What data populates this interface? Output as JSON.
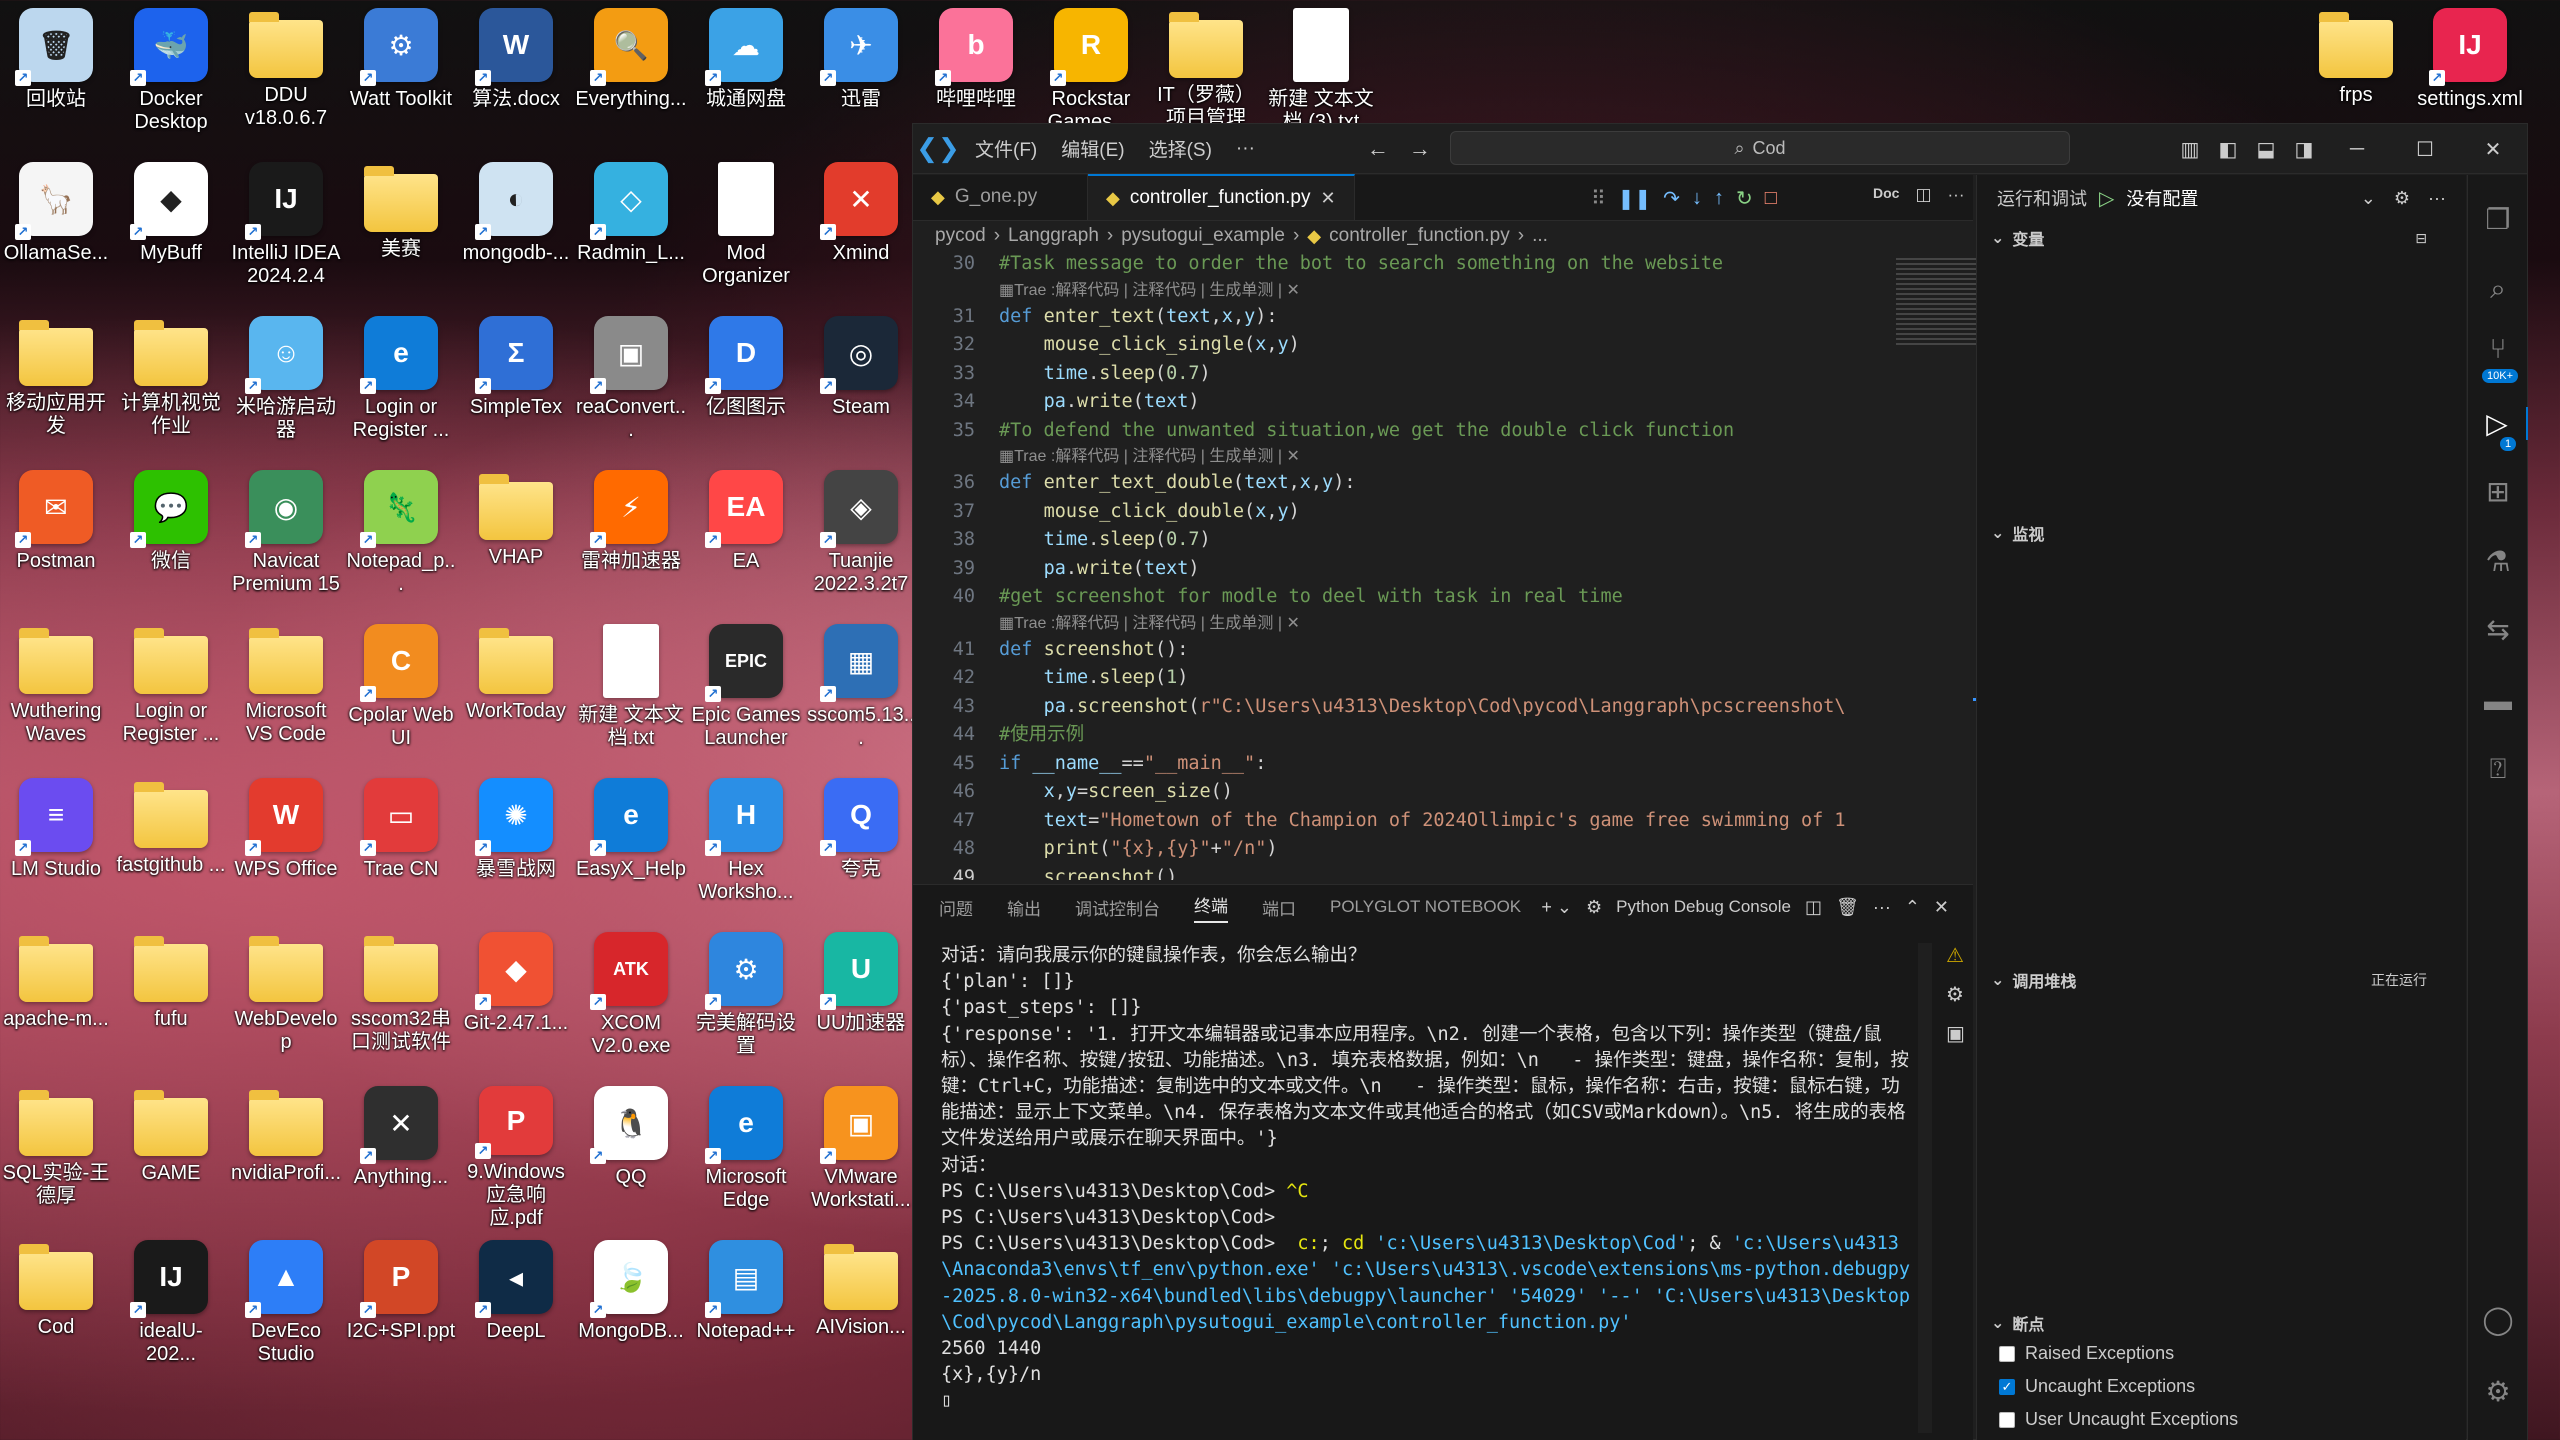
{
  "desktop": {
    "icons": [
      {
        "label": "回收站",
        "glyph": "🗑",
        "bg": "#bcd7ee"
      },
      {
        "label": "Docker Desktop",
        "glyph": "🐳",
        "bg": "#1d63ed"
      },
      {
        "label": "DDU v18.0.6.7",
        "glyph": "",
        "bg": "folder"
      },
      {
        "label": "Watt Toolkit",
        "glyph": "⚙",
        "bg": "#3b7bd6"
      },
      {
        "label": "算法.docx",
        "glyph": "W",
        "bg": "#2b579a"
      },
      {
        "label": "Everything...",
        "glyph": "🔍",
        "bg": "#f39c12"
      },
      {
        "label": "城通网盘",
        "glyph": "☁",
        "bg": "#3ba2e6"
      },
      {
        "label": "迅雷",
        "glyph": "✈",
        "bg": "#3a8ee6"
      },
      {
        "label": "哔哩哔哩",
        "glyph": "b",
        "bg": "#fb7299"
      },
      {
        "label": "Rockstar Games ...",
        "glyph": "R",
        "bg": "#f7b500"
      },
      {
        "label": "IT（罗薇）项目管理",
        "glyph": "",
        "bg": "folder"
      },
      {
        "label": "新建 文本文档 (3).txt",
        "glyph": "",
        "bg": "doc"
      },
      {
        "label": "frps",
        "glyph": "",
        "bg": "folder"
      },
      {
        "label": "settings.xml",
        "glyph": "IJ",
        "bg": "#e8254f"
      },
      {
        "label": "OllamaSe...",
        "glyph": "🦙",
        "bg": "#f5f5f5"
      },
      {
        "label": "MyBuff",
        "glyph": "◆",
        "bg": "#ffffff"
      },
      {
        "label": "IntelliJ IDEA 2024.2.4",
        "glyph": "IJ",
        "bg": "#1a1a1a"
      },
      {
        "label": "美赛",
        "glyph": "",
        "bg": "folder"
      },
      {
        "label": "mongodb-...",
        "glyph": "◐",
        "bg": "#cfe3f2"
      },
      {
        "label": "Radmin_L...",
        "glyph": "◇",
        "bg": "#35b1e0"
      },
      {
        "label": "Mod Organizer",
        "glyph": "",
        "bg": "doc"
      },
      {
        "label": "Xmind",
        "glyph": "✕",
        "bg": "#e23c2c"
      },
      {
        "label": "移动应用开发",
        "glyph": "",
        "bg": "folder"
      },
      {
        "label": "计算机视觉作业",
        "glyph": "",
        "bg": "folder"
      },
      {
        "label": "米哈游启动器",
        "glyph": "☺",
        "bg": "#59b6ef"
      },
      {
        "label": "Login or Register ...",
        "glyph": "e",
        "bg": "#0f7cd8"
      },
      {
        "label": "SimpleTex",
        "glyph": "Σ",
        "bg": "#2f6fd6"
      },
      {
        "label": "reaConvert...",
        "glyph": "▣",
        "bg": "#8a8a8a"
      },
      {
        "label": "亿图图示",
        "glyph": "D",
        "bg": "#2f79e8"
      },
      {
        "label": "Steam",
        "glyph": "◎",
        "bg": "#1b2838"
      },
      {
        "label": "Postman",
        "glyph": "✉",
        "bg": "#ef5b25"
      },
      {
        "label": "微信",
        "glyph": "💬",
        "bg": "#2dc100"
      },
      {
        "label": "Navicat Premium 15",
        "glyph": "◉",
        "bg": "#3a8f5b"
      },
      {
        "label": "Notepad_p...",
        "glyph": "🦎",
        "bg": "#8fd14f"
      },
      {
        "label": "VHAP",
        "glyph": "",
        "bg": "folder"
      },
      {
        "label": "雷神加速器",
        "glyph": "⚡",
        "bg": "#ff6a00"
      },
      {
        "label": "EA",
        "glyph": "EA",
        "bg": "#ff4747"
      },
      {
        "label": "Tuanjie 2022.3.2t7",
        "glyph": "◈",
        "bg": "#444444"
      },
      {
        "label": "Wuthering Waves",
        "glyph": "",
        "bg": "folder"
      },
      {
        "label": "Login or Register ...",
        "glyph": "",
        "bg": "folder"
      },
      {
        "label": "Microsoft VS Code",
        "glyph": "",
        "bg": "folder"
      },
      {
        "label": "Cpolar Web UI",
        "glyph": "C",
        "bg": "#f28c1f"
      },
      {
        "label": "WorkToday",
        "glyph": "",
        "bg": "folder"
      },
      {
        "label": "新建 文本文档.txt",
        "glyph": "",
        "bg": "doc"
      },
      {
        "label": "Epic Games Launcher",
        "glyph": "EPIC",
        "bg": "#2a2a2a"
      },
      {
        "label": "sscom5.13...",
        "glyph": "▦",
        "bg": "#2d6fb5"
      },
      {
        "label": "LM Studio",
        "glyph": "≡",
        "bg": "#6b4cf0"
      },
      {
        "label": "fastgithub ...",
        "glyph": "",
        "bg": "folder"
      },
      {
        "label": "WPS Office",
        "glyph": "W",
        "bg": "#e33b2e"
      },
      {
        "label": "Trae CN",
        "glyph": "▭",
        "bg": "#e23b3b"
      },
      {
        "label": "暴雪战网",
        "glyph": "✺",
        "bg": "#148eff"
      },
      {
        "label": "EasyX_Help",
        "glyph": "e",
        "bg": "#0f7cd8"
      },
      {
        "label": "Hex Worksho...",
        "glyph": "H",
        "bg": "#2b8fe6"
      },
      {
        "label": "夸克",
        "glyph": "Q",
        "bg": "#3a6cf4"
      },
      {
        "label": "apache-m...",
        "glyph": "",
        "bg": "folder"
      },
      {
        "label": "fufu",
        "glyph": "",
        "bg": "folder"
      },
      {
        "label": "WebDevelop",
        "glyph": "",
        "bg": "folder"
      },
      {
        "label": "sscom32串口测试软件",
        "glyph": "",
        "bg": "folder"
      },
      {
        "label": "Git-2.47.1...",
        "glyph": "◆",
        "bg": "#f05133"
      },
      {
        "label": "XCOM V2.0.exe",
        "glyph": "ATK",
        "bg": "#d7262b"
      },
      {
        "label": "完美解码设置",
        "glyph": "⚙",
        "bg": "#2e86de"
      },
      {
        "label": "UU加速器",
        "glyph": "U",
        "bg": "#18b7a3"
      },
      {
        "label": "SQL实验-王德厚",
        "glyph": "",
        "bg": "folder"
      },
      {
        "label": "GAME",
        "glyph": "",
        "bg": "folder"
      },
      {
        "label": "nvidiaProfi...",
        "glyph": "",
        "bg": "folder"
      },
      {
        "label": "Anything...",
        "glyph": "✕",
        "bg": "#2f2f2f"
      },
      {
        "label": "9.Windows 应急响应.pdf",
        "glyph": "P",
        "bg": "#e23b3b"
      },
      {
        "label": "QQ",
        "glyph": "🐧",
        "bg": "#ffffff"
      },
      {
        "label": "Microsoft Edge",
        "glyph": "e",
        "bg": "#0f7cd8"
      },
      {
        "label": "VMware Workstati...",
        "glyph": "▣",
        "bg": "#f7931e"
      },
      {
        "label": "Cod",
        "glyph": "",
        "bg": "folder"
      },
      {
        "label": "idealU-202...",
        "glyph": "IJ",
        "bg": "#1a1a1a"
      },
      {
        "label": "DevEco Studio",
        "glyph": "▲",
        "bg": "#2d7ef7"
      },
      {
        "label": "I2C+SPI.ppt",
        "glyph": "P",
        "bg": "#d24726"
      },
      {
        "label": "DeepL",
        "glyph": "◂",
        "bg": "#0f2b46"
      },
      {
        "label": "MongoDB...",
        "glyph": "🍃",
        "bg": "#ffffff"
      },
      {
        "label": "Notepad++",
        "glyph": "▤",
        "bg": "#2f8fe0"
      },
      {
        "label": "AIVision...",
        "glyph": "",
        "bg": "folder"
      }
    ]
  },
  "window": {
    "menu": [
      "文件(F)",
      "编辑(E)",
      "选择(S)",
      "···"
    ],
    "command_center": "Cod",
    "tabs": [
      {
        "label": "G_one.py",
        "active": false
      },
      {
        "label": "controller_function.py",
        "active": true
      }
    ],
    "breadcrumb": [
      "pycod",
      "Langgraph",
      "pysutogui_example",
      "controller_function.py",
      "..."
    ],
    "doc_label": "Doc"
  },
  "code": {
    "lens": "Trae :解释代码 | 注释代码 | 生成单测 | ✕",
    "lines": [
      {
        "n": "30",
        "html": "<span class=\"comment\">#Task message to order the bot to search something on the website</span>"
      },
      {
        "lens": true
      },
      {
        "n": "31",
        "html": "<span class=\"kw\">def</span> <span class=\"fn\">enter_text</span>(<span class=\"var\">text</span>,<span class=\"var\">x</span>,<span class=\"var\">y</span>):"
      },
      {
        "n": "32",
        "html": "    <span class=\"fn\">mouse_click_single</span>(<span class=\"var\">x</span>,<span class=\"var\">y</span>)"
      },
      {
        "n": "33",
        "html": "    <span class=\"var\">time</span>.<span class=\"fn\">sleep</span>(<span class=\"num\">0.7</span>)"
      },
      {
        "n": "34",
        "html": "    <span class=\"var\">pa</span>.<span class=\"fn\">write</span>(<span class=\"var\">text</span>)"
      },
      {
        "n": "35",
        "html": "<span class=\"comment\">#To defend the unwanted situation,we get the double click function</span>"
      },
      {
        "lens": true
      },
      {
        "n": "36",
        "html": "<span class=\"kw\">def</span> <span class=\"fn\">enter_text_double</span>(<span class=\"var\">text</span>,<span class=\"var\">x</span>,<span class=\"var\">y</span>):"
      },
      {
        "n": "37",
        "html": "    <span class=\"fn\">mouse_click_double</span>(<span class=\"var\">x</span>,<span class=\"var\">y</span>)"
      },
      {
        "n": "38",
        "html": "    <span class=\"var\">time</span>.<span class=\"fn\">sleep</span>(<span class=\"num\">0.7</span>)"
      },
      {
        "n": "39",
        "html": "    <span class=\"var\">pa</span>.<span class=\"fn\">write</span>(<span class=\"var\">text</span>)"
      },
      {
        "n": "40",
        "html": "<span class=\"comment\">#get screenshot for modle to deel with task in real time</span>"
      },
      {
        "lens": true
      },
      {
        "n": "41",
        "html": "<span class=\"kw\">def</span> <span class=\"fn\">screenshot</span>():"
      },
      {
        "n": "42",
        "html": "    <span class=\"var\">time</span>.<span class=\"fn\">sleep</span>(<span class=\"num\">1</span>)"
      },
      {
        "n": "43",
        "html": "    <span class=\"var\">pa</span>.<span class=\"fn\">screenshot</span>(<span class=\"str\">r\"C:\\Users\\u4313\\Desktop\\Cod\\pycod\\Langgraph\\pcscreenshot\\</span>"
      },
      {
        "n": "44",
        "html": "<span class=\"comment\">#使用示例</span>"
      },
      {
        "n": "45",
        "html": "<span class=\"kw\">if</span> <span class=\"var\">__name__</span>==<span class=\"str\">\"__main__\"</span>:"
      },
      {
        "n": "46",
        "html": "    <span class=\"var\">x</span>,<span class=\"var\">y</span>=<span class=\"fn\">screen_size</span>()"
      },
      {
        "n": "47",
        "html": "    <span class=\"var\">text</span>=<span class=\"str\">\"Hometown of the Champion of 2024Ollimpic's game free swimming of 1</span>"
      },
      {
        "n": "48",
        "html": "    <span class=\"fn\">print</span>(<span class=\"str\">\"{x},{y}\"</span>+<span class=\"str\">\"/n\"</span>)"
      },
      {
        "n": "49",
        "html": "    <span class=\"fn\">screenshot</span>()",
        "current": true
      }
    ]
  },
  "panel": {
    "tabs": [
      "问题",
      "输出",
      "调试控制台",
      "终端",
      "端口",
      "POLYGLOT NOTEBOOK"
    ],
    "active_tab": "终端",
    "terminal_name": "Python Debug Console",
    "terminal_html": "对话：请向我展示你的键鼠操作表，你会怎么输出？\n{'plan': []}\n{'past_steps': []}\n{'response': '1. 打开文本编辑器或记事本应用程序。\\n2. 创建一个表格，包含以下列：操作类型（键盘/鼠标）、操作名称、按键/按钮、功能描述。\\n3. 填充表格数据，例如：\\n   - 操作类型：键盘，操作名称：复制，按键：Ctrl+C，功能描述：复制选中的文本或文件。\\n   - 操作类型：鼠标，操作名称：右击，按键：鼠标右键，功能描述：显示上下文菜单。\\n4. 保存表格为文本文件或其他适合的格式（如CSV或Markdown）。\\n5. 将生成的表格文件发送给用户或展示在聊天界面中。'}\n对话：\nPS C:\\Users\\u4313\\Desktop\\Cod> <span class=\"cmd-y\">^C</span>\nPS C:\\Users\\u4313\\Desktop\\Cod>\nPS C:\\Users\\u4313\\Desktop\\Cod>  <span class=\"cmd-y\">c:</span>; <span class=\"cmd-y\">cd</span> <span class=\"path\">'c:\\Users\\u4313\\Desktop\\Cod'</span>; & <span class=\"path\">'c:\\Users\\u4313\\Anaconda3\\envs\\tf_env\\python.exe' 'c:\\Users\\u4313\\.vscode\\extensions\\ms-python.debugpy-2025.8.0-win32-x64\\bundled\\libs\\debugpy\\launcher'</span> <span class=\"path\">'54029'</span> <span class=\"path\">'--'</span> <span class=\"path\">'C:\\Users\\u4313\\Desktop\\Cod\\pycod\\Langgraph\\pysutogui_example\\controller_function.py'</span>\n2560 1440\n{x},{y}/n\n▯"
  },
  "debug": {
    "title": "运行和调试",
    "config": "没有配置",
    "sections": {
      "variables": "变量",
      "watch": "监视",
      "callstack": "调用堆栈",
      "callstack_status": "正在运行",
      "breakpoints": "断点"
    },
    "breakpoints": [
      {
        "label": "Raised Exceptions",
        "checked": false
      },
      {
        "label": "Uncaught Exceptions",
        "checked": true
      },
      {
        "label": "User Uncaught Exceptions",
        "checked": false
      }
    ]
  },
  "activity": {
    "badges": [
      "10K+",
      "1"
    ]
  }
}
